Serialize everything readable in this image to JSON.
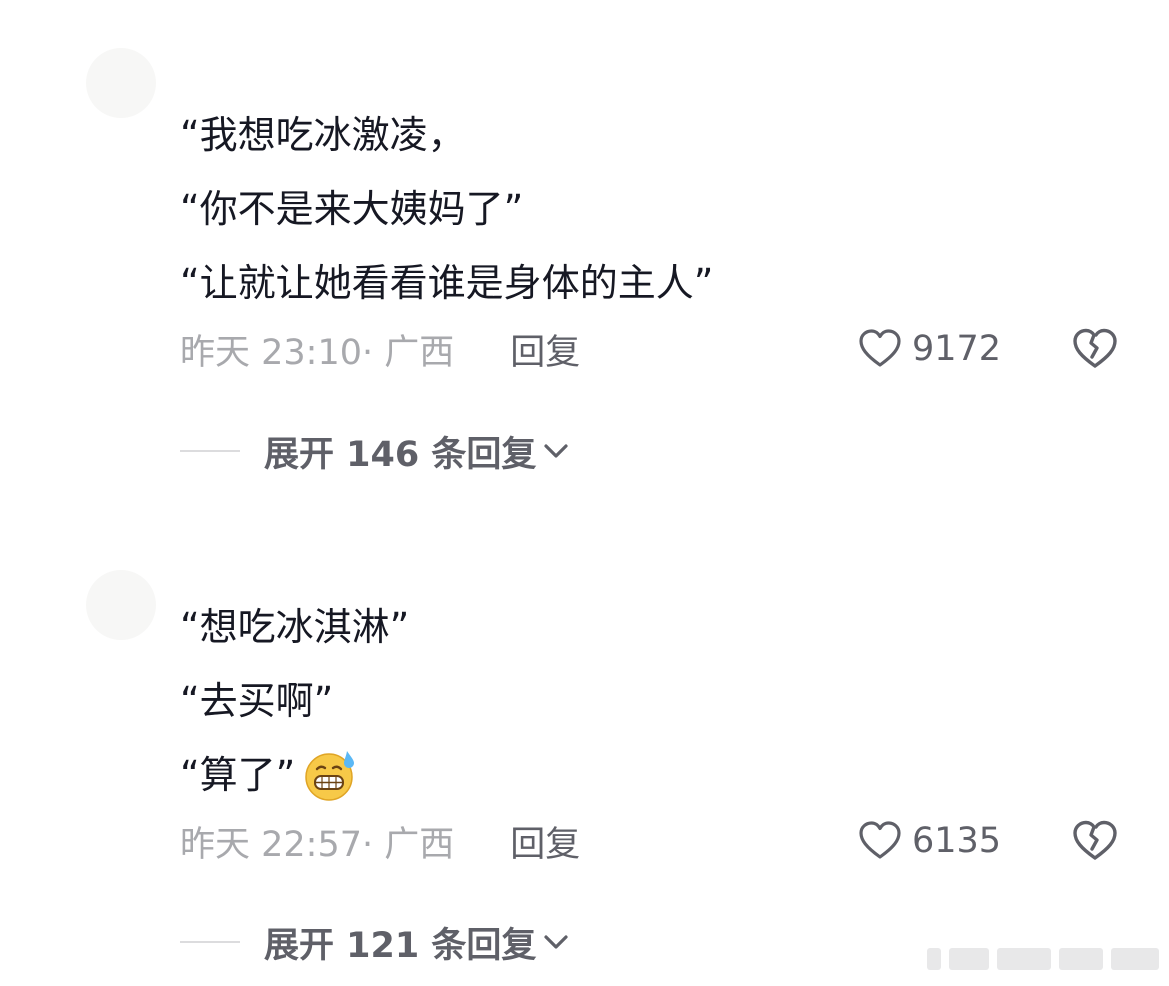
{
  "comments": [
    {
      "lines": [
        "“我想吃冰激凌，",
        "“你不是来大姨妈了”",
        "“让就让她看看谁是身体的主人”"
      ],
      "time": "昨天 23:10",
      "location": "· 广西",
      "reply_label": "回复",
      "likes": "9172",
      "expand_label": "展开 146 条回复"
    },
    {
      "lines": [
        "“想吃冰淇淋”",
        "“去买啊”",
        "“算了”"
      ],
      "emoji": "grinning-sweat-emoji",
      "time": "昨天 22:57",
      "location": "· 广西",
      "reply_label": "回复",
      "likes": "6135",
      "expand_label": "展开 121 条回复"
    }
  ],
  "colors": {
    "text_primary": "#161823",
    "text_meta": "#a8a9ad",
    "text_action": "#5f6068",
    "divider": "#dcdcde"
  },
  "icons": [
    "heart-icon",
    "broken-heart-icon",
    "chevron-down-icon"
  ]
}
